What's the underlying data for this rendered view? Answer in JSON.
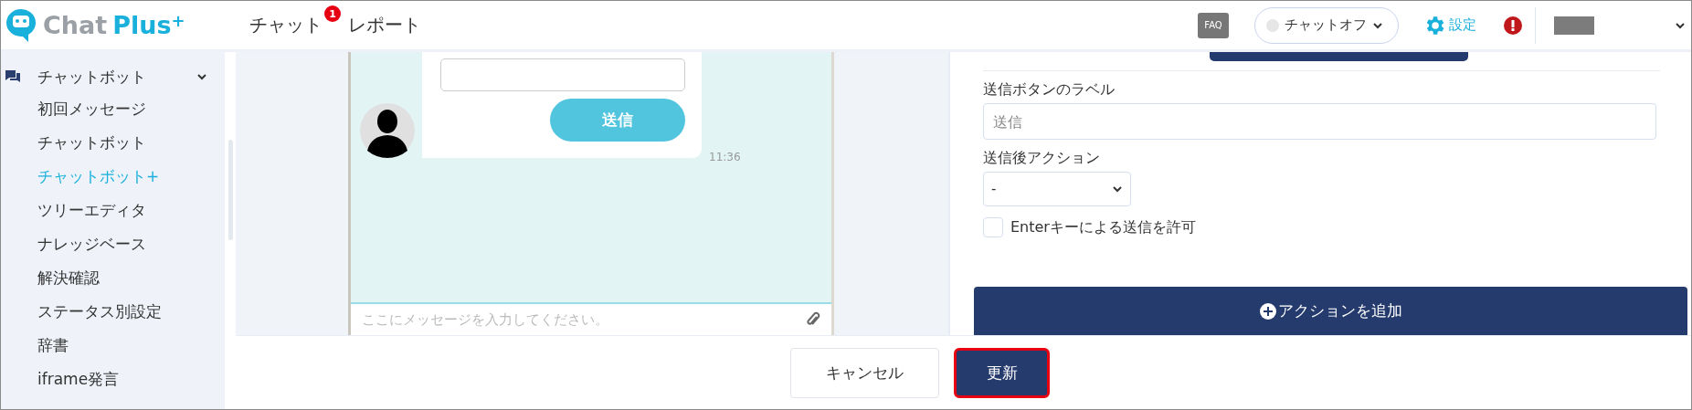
{
  "header": {
    "logo": {
      "word1": "Chat",
      "word2": "Plus",
      "mark": "+"
    },
    "nav": [
      {
        "label": "チャット",
        "badge": "1"
      },
      {
        "label": "レポート"
      }
    ],
    "faq": "FAQ",
    "status": {
      "label": "チャットオフ",
      "online": false
    },
    "settings": "設定"
  },
  "sidebar": {
    "group": {
      "label": "チャットボット",
      "expanded": true
    },
    "items": [
      {
        "label": "初回メッセージ",
        "selected": false
      },
      {
        "label": "チャットボット",
        "selected": false
      },
      {
        "label": "チャットボット+",
        "selected": true
      },
      {
        "label": "ツリーエディタ",
        "selected": false
      },
      {
        "label": "ナレッジベース",
        "selected": false
      },
      {
        "label": "解決確認",
        "selected": false
      },
      {
        "label": "ステータス別設定",
        "selected": false
      },
      {
        "label": "辞書",
        "selected": false
      },
      {
        "label": "iframe発言",
        "selected": false
      }
    ]
  },
  "preview": {
    "send_button": "送信",
    "time": "11:36",
    "message_placeholder": "ここにメッセージを入力してください。"
  },
  "form": {
    "button_label": {
      "label": "送信ボタンのラベル",
      "placeholder": "送信"
    },
    "after_action": {
      "label": "送信後アクション",
      "value": "-"
    },
    "enter_key": {
      "label": "Enterキーによる送信を許可",
      "checked": false
    },
    "add_action": "アクションを追加"
  },
  "footer": {
    "cancel": "キャンセル",
    "update": "更新"
  }
}
